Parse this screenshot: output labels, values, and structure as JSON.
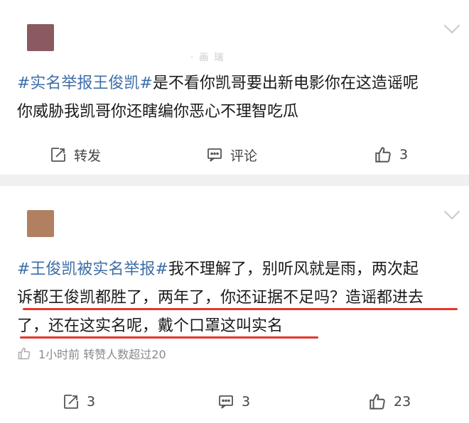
{
  "post1": {
    "author_faint": "· 画  瑞",
    "hashtag": "#实名举报王俊凯#",
    "text_line1": "是不看你凯哥要出新电影你在这造谣呢",
    "text_line2": "你威胁我凯哥你还瞎编你恶心不理智吃瓜",
    "actions": {
      "repost_label": "转发",
      "comment_label": "评论",
      "like_count": "3"
    },
    "avatar_color": "#8a5a60"
  },
  "post2": {
    "hashtag": "#王俊凯被实名举报#",
    "text_line1": "我不理解了，别听风就是雨，两次起",
    "text_line2": "诉都王俊凯都胜了，两年了，你还证据不足吗？造谣都进去",
    "text_line3": "了，还在这实名呢，戴个口罩这叫实名",
    "meta_text": "1小时前 转赞人数超过20",
    "actions": {
      "repost_count": "3",
      "comment_count": "3",
      "like_count": "23"
    },
    "avatar_color": "#b08060",
    "underline_color": "#e8342a"
  },
  "colors": {
    "hashtag": "#3c6ea8",
    "background": "#ffffff",
    "divider": "#f0f0f0"
  }
}
